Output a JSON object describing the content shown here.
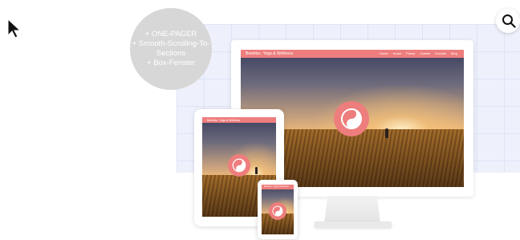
{
  "bubble": {
    "line1": "+ ONE-PAGER",
    "line2": "+ Smooth-Scrolling-To-",
    "line3": "Sections",
    "line4": "+ Box-Fenster"
  },
  "site": {
    "brand": "Bewirtsc. Yoga & Wellness",
    "nav": [
      "Home",
      "Kurse",
      "Preise",
      "Galerie",
      "Kontakt",
      "Blog"
    ]
  },
  "colors": {
    "accent": "#ee7d7d",
    "grid": "#eef0fb",
    "bubble": "#d7d7d7"
  },
  "icons": {
    "cursor": "cursor-arrow-icon",
    "search": "search-icon",
    "logo": "yin-yang-icon"
  }
}
